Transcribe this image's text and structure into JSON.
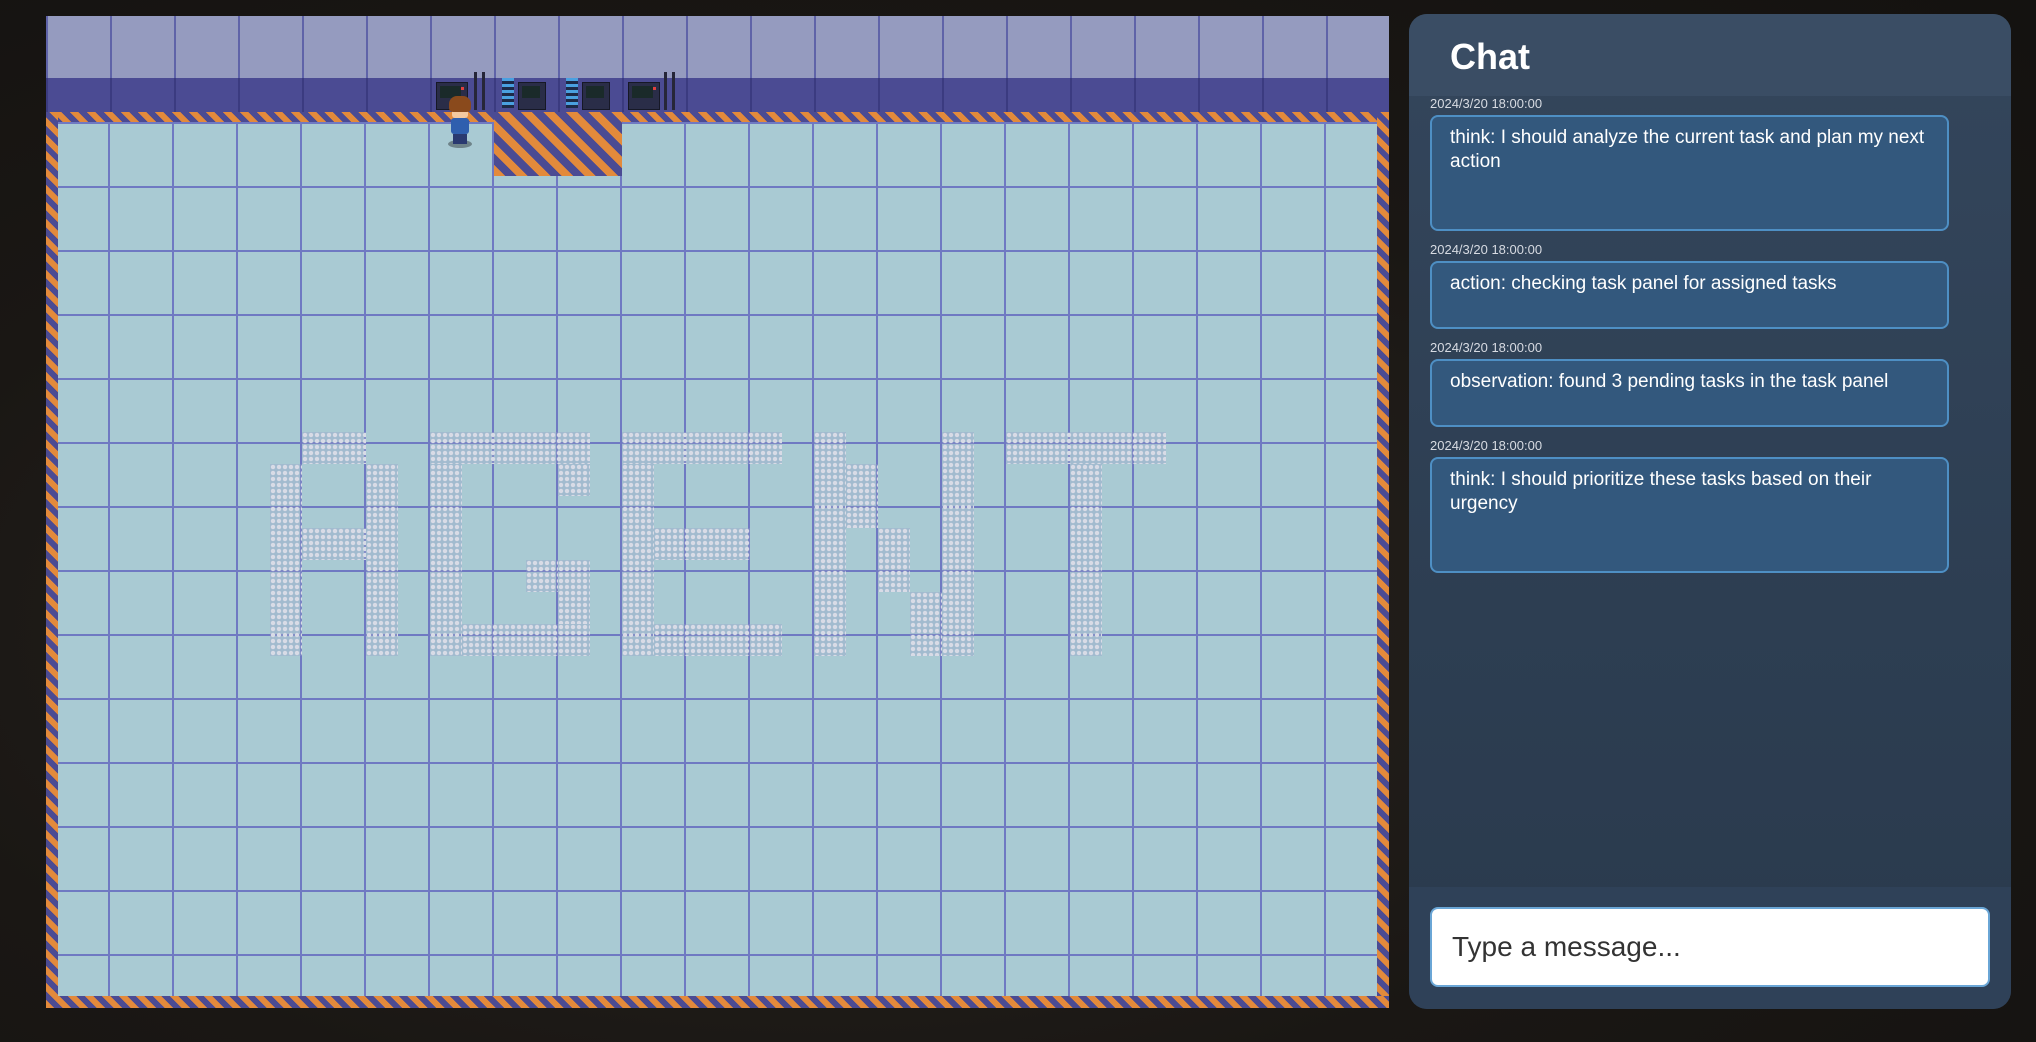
{
  "chat": {
    "title": "Chat",
    "messages": [
      {
        "timestamp": "2024/3/20 18:00:00",
        "text": "think: I should analyze the current task and plan my next action"
      },
      {
        "timestamp": "2024/3/20 18:00:00",
        "text": "action: checking task panel for assigned tasks"
      },
      {
        "timestamp": "2024/3/20 18:00:00",
        "text": "observation: found 3 pending tasks in the task panel"
      },
      {
        "timestamp": "2024/3/20 18:00:00",
        "text": "think: I should prioritize these tasks based on their urgency"
      }
    ],
    "input": {
      "placeholder": "Type a message...",
      "value": ""
    }
  },
  "game": {
    "floor_text": "AGENT",
    "colors": {
      "floor": "#a9cad3",
      "grid": "#6f79c2",
      "wall": "#959bbf",
      "hazard_orange": "#e38a3b",
      "hazard_purple": "#4b4b93"
    }
  }
}
